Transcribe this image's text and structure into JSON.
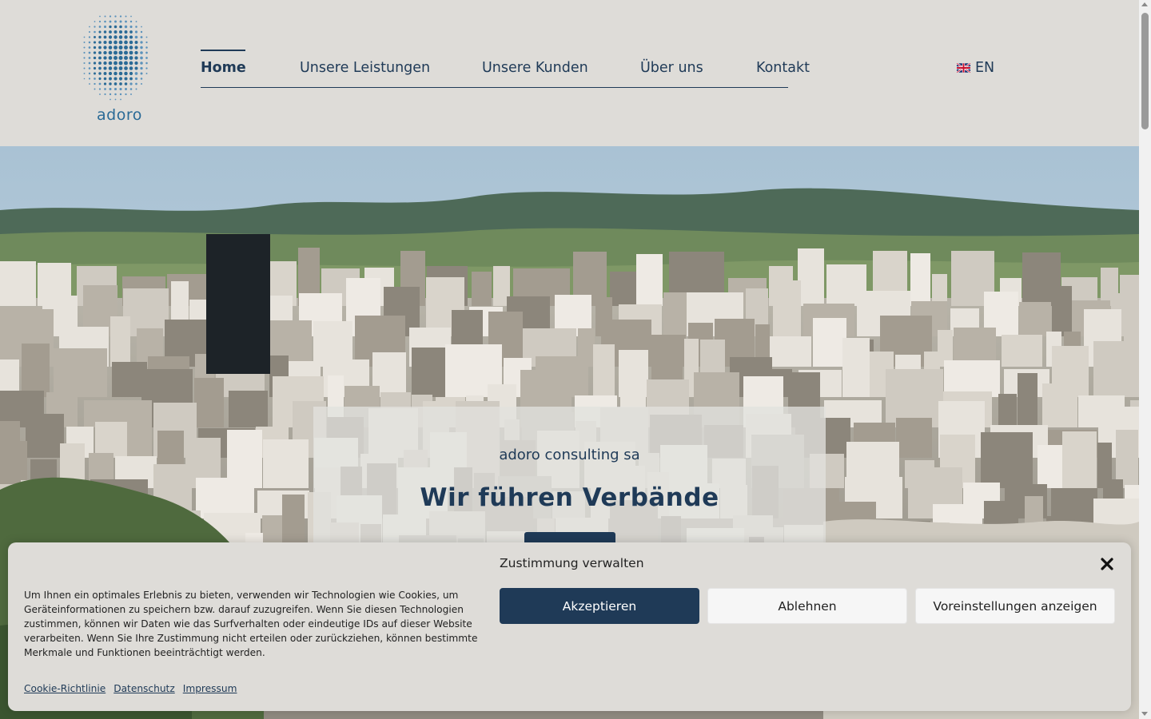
{
  "brand": {
    "logo_text": "adoro",
    "color": "#2a6a96"
  },
  "nav": {
    "items": [
      {
        "label": "Home",
        "active": true
      },
      {
        "label": "Unsere Leistungen",
        "active": false
      },
      {
        "label": "Unsere Kunden",
        "active": false
      },
      {
        "label": "Über uns",
        "active": false
      },
      {
        "label": "Kontakt",
        "active": false
      }
    ],
    "language": {
      "label": "EN",
      "flag_icon": "uk-flag-icon"
    }
  },
  "hero": {
    "subtitle": "adoro consulting sa",
    "title": "Wir führen Verbände"
  },
  "cookie_banner": {
    "title": "Zustimmung verwalten",
    "text": "Um Ihnen ein optimales Erlebnis zu bieten, verwenden wir Technologien wie Cookies, um Geräteinformationen zu speichern bzw. darauf zuzugreifen. Wenn Sie diesen Technologien zustimmen, können wir Daten wie das Surfverhalten oder eindeutige IDs auf dieser Website verarbeiten. Wenn Sie Ihre Zustimmung nicht erteilen oder zurückziehen, können bestimmte Merkmale und Funktionen beeinträchtigt werden.",
    "buttons": {
      "accept": "Akzeptieren",
      "deny": "Ablehnen",
      "preferences": "Voreinstellungen anzeigen"
    },
    "links": [
      "Cookie-Richtlinie",
      "Datenschutz",
      "Impressum"
    ],
    "close_icon": "close-icon"
  },
  "colors": {
    "primary": "#1f3a57",
    "background": "#dedcd8",
    "button_light": "#f6f6f6"
  }
}
